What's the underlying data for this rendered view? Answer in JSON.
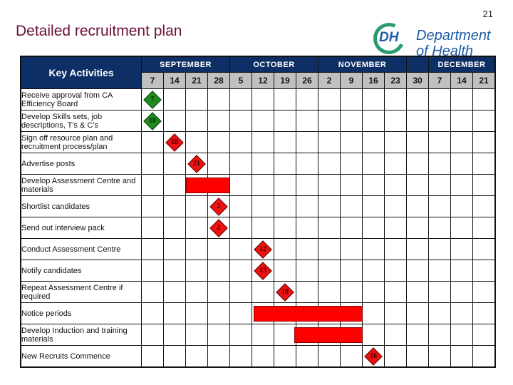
{
  "page_number": "21",
  "title": "Detailed recruitment plan",
  "logo": {
    "initials": "DH",
    "line1": "Department",
    "line2": "of Health"
  },
  "table": {
    "key_header": "Key Activities",
    "months": [
      {
        "name": "SEPTEMBER",
        "span": 4
      },
      {
        "name": "OCTOBER",
        "span": 4
      },
      {
        "name": "NOVEMBER",
        "span": 4
      },
      {
        "name": "",
        "span": 1
      },
      {
        "name": "DECEMBER",
        "span": 3
      }
    ],
    "weeks": [
      "7",
      "14",
      "21",
      "28",
      "5",
      "12",
      "19",
      "26",
      "2",
      "9",
      "16",
      "23",
      "30",
      "7",
      "14",
      "21"
    ],
    "colors": {
      "milestone_done": "#1f8a1f",
      "milestone_todo": "#ee1111",
      "bar": "#ff0000",
      "header_bg": "#0d2f66",
      "week_bg": "#c0c0c0"
    },
    "activities": [
      {
        "label": "Receive approval from CA Efficiency Board",
        "type": "milestone",
        "status": "done",
        "week_index": 0,
        "offset": 0.0,
        "day": "7"
      },
      {
        "label": "Develop Skills sets, job descriptions, T's & C's",
        "type": "milestone",
        "status": "done",
        "week_index": 0,
        "offset": 0.0,
        "day": "10"
      },
      {
        "label": "Sign off resource plan and recruitment process/plan",
        "type": "milestone",
        "status": "todo",
        "week_index": 1,
        "offset": 0.0,
        "day": "18"
      },
      {
        "label": "Advertise posts",
        "type": "milestone",
        "status": "todo",
        "week_index": 2,
        "offset": 0.0,
        "day": "21"
      },
      {
        "label": "Develop Assessment Centre and materials",
        "type": "bar",
        "start_week": 2.0,
        "end_week": 4.0
      },
      {
        "label": "Shortlist candidates",
        "type": "milestone",
        "status": "todo",
        "week_index": 3,
        "offset": 0.0,
        "day": "2"
      },
      {
        "label": "Send out interview pack",
        "type": "milestone",
        "status": "todo",
        "week_index": 3,
        "offset": 0.0,
        "day": "2"
      },
      {
        "label": "Conduct  Assessment Centre",
        "type": "milestone",
        "status": "todo",
        "week_index": 5,
        "offset": 0.0,
        "day": "12"
      },
      {
        "label": "Notify candidates",
        "type": "milestone",
        "status": "todo",
        "week_index": 5,
        "offset": 0.0,
        "day": "13"
      },
      {
        "label": "Repeat  Assessment Centre if required",
        "type": "milestone",
        "status": "todo",
        "week_index": 6,
        "offset": 0.0,
        "day": "19"
      },
      {
        "label": "Notice periods",
        "type": "bar",
        "start_week": 5.05,
        "end_week": 10.0
      },
      {
        "label": "Develop Induction and training materials",
        "type": "bar",
        "start_week": 6.9,
        "end_week": 10.0
      },
      {
        "label": "New Recruits Commence",
        "type": "milestone",
        "status": "todo",
        "week_index": 10,
        "offset": 0.0,
        "day": "16"
      }
    ]
  }
}
